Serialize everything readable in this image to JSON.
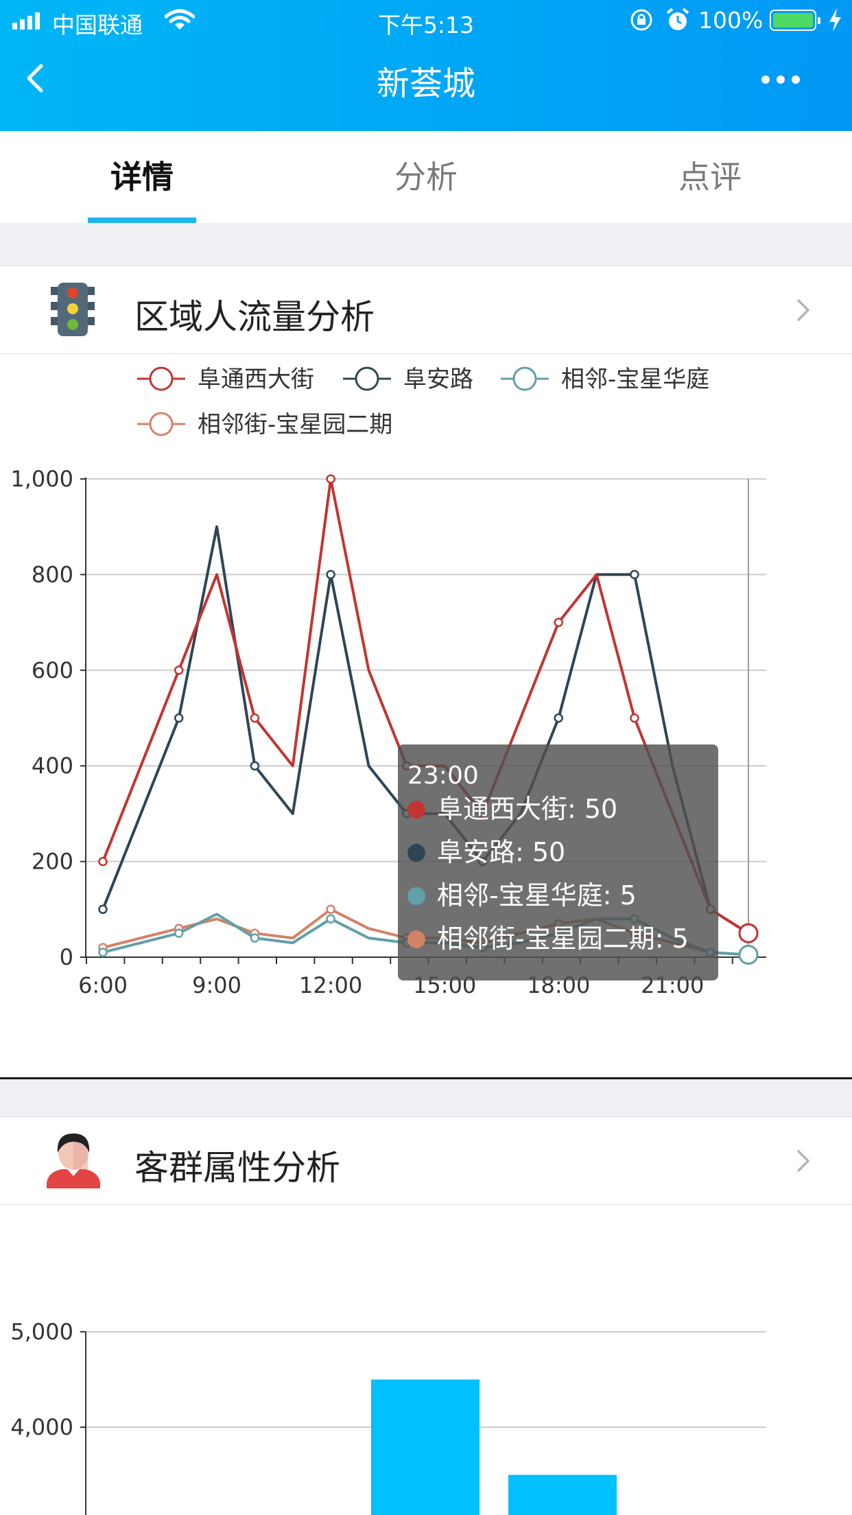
{
  "status_bar": {
    "carrier": "中国联通",
    "time": "下午5:13",
    "battery_pct": "100%",
    "battery_level": 1.0,
    "battery_color": "#4cd964"
  },
  "nav": {
    "title": "新荟城",
    "back_icon": "chevron-left-icon",
    "more_icon": "more-dots-icon"
  },
  "tabs": [
    {
      "label": "详情",
      "active": true
    },
    {
      "label": "分析",
      "active": false
    },
    {
      "label": "点评",
      "active": false
    }
  ],
  "sections": {
    "traffic": {
      "title": "区域人流量分析",
      "icon": "traffic-light-icon"
    },
    "customer": {
      "title": "客群属性分析",
      "icon": "person-avatar-icon"
    }
  },
  "colors": {
    "header_start": "#00b6f6",
    "header_end": "#0099f5",
    "tab_indicator": "#1fb4ee",
    "bar": "#00c0ff"
  },
  "chart_data": [
    {
      "type": "line",
      "x": [
        "6:00",
        "7:00",
        "8:00",
        "9:00",
        "10:00",
        "11:00",
        "12:00",
        "13:00",
        "14:00",
        "15:00",
        "16:00",
        "17:00",
        "18:00",
        "19:00",
        "20:00",
        "21:00",
        "22:00",
        "23:00"
      ],
      "x_tick_labels": [
        "6:00",
        "9:00",
        "12:00",
        "15:00",
        "18:00",
        "21:00"
      ],
      "ylim": [
        0,
        1000
      ],
      "y_tick_labels": [
        "0",
        "200",
        "400",
        "600",
        "800",
        "1,000"
      ],
      "grid": true,
      "legend_position": "top",
      "series": [
        {
          "name": "阜通西大街",
          "color": "#c23531",
          "values": [
            200,
            400,
            600,
            800,
            500,
            400,
            1000,
            600,
            400,
            400,
            300,
            500,
            700,
            800,
            500,
            300,
            100,
            50
          ]
        },
        {
          "name": "阜安路",
          "color": "#2f4554",
          "values": [
            100,
            300,
            500,
            900,
            400,
            300,
            800,
            400,
            300,
            300,
            200,
            300,
            500,
            800,
            800,
            400,
            100,
            50
          ]
        },
        {
          "name": "相邻-宝星华庭",
          "color": "#61a0a8",
          "values": [
            10,
            30,
            50,
            90,
            40,
            30,
            80,
            40,
            30,
            30,
            20,
            30,
            50,
            80,
            80,
            40,
            10,
            5
          ]
        },
        {
          "name": "相邻街-宝星园二期",
          "color": "#d48265",
          "values": [
            20,
            40,
            60,
            80,
            50,
            40,
            100,
            60,
            40,
            40,
            30,
            50,
            70,
            80,
            50,
            30,
            10,
            5
          ]
        }
      ],
      "tooltip": {
        "title": "23:00",
        "lines": [
          "阜通西大街: 50",
          "阜安路: 50",
          "相邻-宝星华庭: 5",
          "相邻街-宝星园二期: 5"
        ]
      }
    },
    {
      "type": "bar",
      "y_tick_labels": [
        "4,000",
        "5,000"
      ],
      "ylim": [
        3000,
        5000
      ],
      "values_visible": [
        4500,
        3500
      ],
      "grid": true
    }
  ]
}
